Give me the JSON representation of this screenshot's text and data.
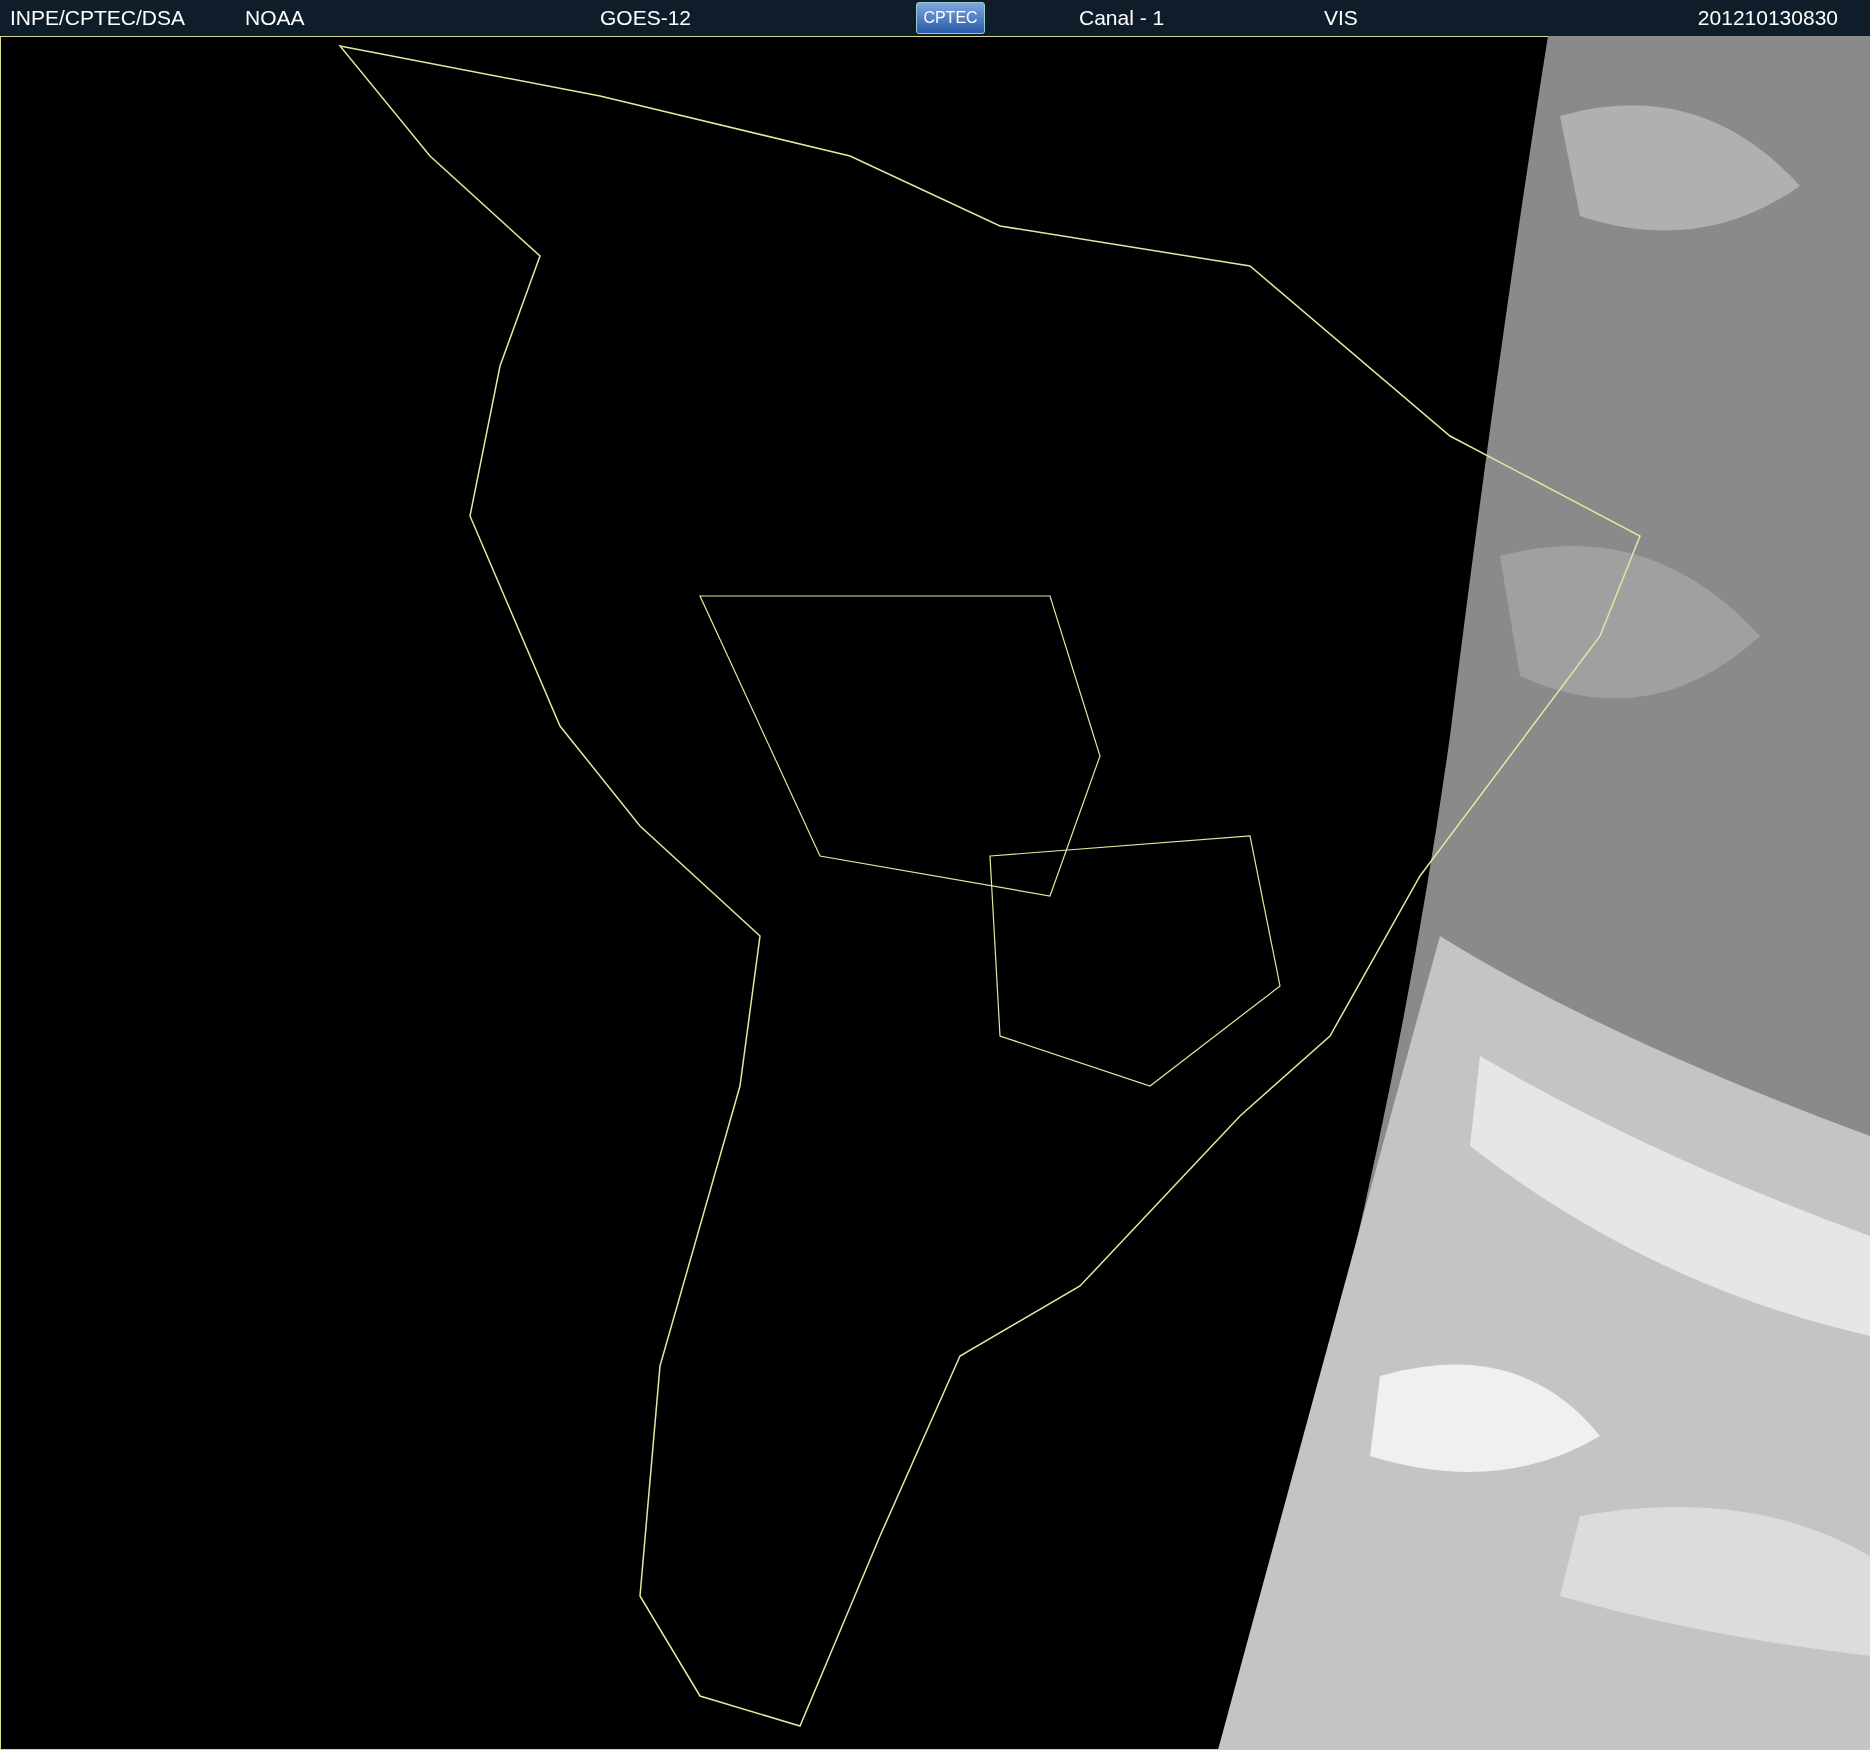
{
  "header": {
    "source": "INPE/CPTEC/DSA",
    "agency": "NOAA",
    "satellite": "GOES-12",
    "logo": "CPTEC",
    "channel": "Canal - 1",
    "band": "VIS",
    "timestamp": "201210130830"
  }
}
